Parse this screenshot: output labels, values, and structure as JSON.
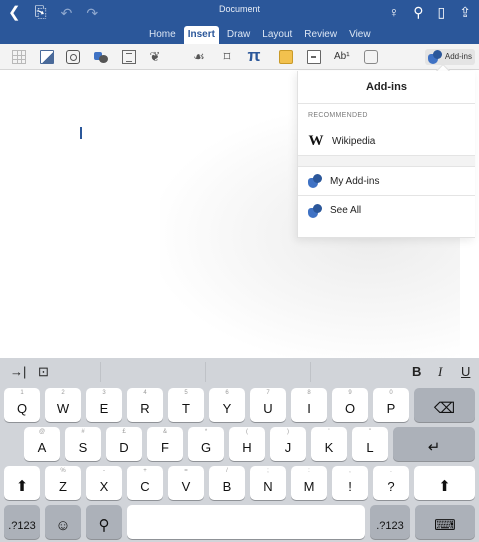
{
  "colors": {
    "titlebar_bg": "#2b579a",
    "ribbon_bg": "#f3f3f3",
    "keyboard_bg": "#d1d4d9",
    "key_bg": "#ffffff",
    "key_gray_bg": "#acb1b9"
  },
  "titlebar": {
    "doc_title": "Document",
    "left_icons": [
      "back-icon",
      "file-icon",
      "undo-icon",
      "redo-icon"
    ],
    "right_icons": [
      "lightbulb-icon",
      "search-icon",
      "tablet-icon",
      "share-icon"
    ],
    "back_glyph": "❮",
    "file_glyph": "⎘",
    "undo_glyph": "↶",
    "redo_glyph": "↷",
    "bulb_glyph": "♀",
    "search_glyph": "⚲",
    "tablet_glyph": "▯",
    "share_glyph": "⇪"
  },
  "tabs": [
    {
      "label": "Home",
      "active": false
    },
    {
      "label": "Insert",
      "active": true
    },
    {
      "label": "Draw",
      "active": false
    },
    {
      "label": "Layout",
      "active": false
    },
    {
      "label": "Review",
      "active": false
    },
    {
      "label": "View",
      "active": false
    }
  ],
  "ribbon": {
    "icons": [
      "table-icon",
      "picture-icon",
      "camera-icon",
      "shapes-icon",
      "textbox-icon",
      "smartart-icon",
      "symbols-icon",
      "comment-icon",
      "equation-icon",
      "header-icon",
      "page-number-icon",
      "footnote-icon",
      "link-icon"
    ],
    "smartart_glyph": "❦",
    "symbols_glyph": "☙",
    "comment_glyph": "⌑",
    "equation_glyph": "π",
    "footnote_label": "Ab¹",
    "addins_label": "Add-ins"
  },
  "popover": {
    "title": "Add-ins",
    "section_label": "RECOMMENDED",
    "recommended": [
      {
        "icon": "wikipedia-icon",
        "glyph": "W",
        "label": "Wikipedia"
      }
    ],
    "items": [
      {
        "icon": "my-addins-icon",
        "label": "My Add-ins"
      },
      {
        "icon": "see-all-icon",
        "label": "See All"
      }
    ]
  },
  "keyboard": {
    "toolbar": {
      "tab_glyph": "→|",
      "paste_glyph": "⊡",
      "bold": "B",
      "italic": "I",
      "underline": "U"
    },
    "row1": [
      {
        "ch": "Q",
        "hint": "1"
      },
      {
        "ch": "W",
        "hint": "2"
      },
      {
        "ch": "E",
        "hint": "3"
      },
      {
        "ch": "R",
        "hint": "4"
      },
      {
        "ch": "T",
        "hint": "5"
      },
      {
        "ch": "Y",
        "hint": "6"
      },
      {
        "ch": "U",
        "hint": "7"
      },
      {
        "ch": "I",
        "hint": "8"
      },
      {
        "ch": "O",
        "hint": "9"
      },
      {
        "ch": "P",
        "hint": "0"
      }
    ],
    "row2": [
      {
        "ch": "A",
        "hint": "@"
      },
      {
        "ch": "S",
        "hint": "#"
      },
      {
        "ch": "D",
        "hint": "£"
      },
      {
        "ch": "F",
        "hint": "&"
      },
      {
        "ch": "G",
        "hint": "*"
      },
      {
        "ch": "H",
        "hint": "("
      },
      {
        "ch": "J",
        "hint": ")"
      },
      {
        "ch": "K",
        "hint": "'"
      },
      {
        "ch": "L",
        "hint": "\""
      }
    ],
    "row3": [
      {
        "ch": "Z",
        "hint": "%"
      },
      {
        "ch": "X",
        "hint": "-"
      },
      {
        "ch": "C",
        "hint": "+"
      },
      {
        "ch": "V",
        "hint": "="
      },
      {
        "ch": "B",
        "hint": "/"
      },
      {
        "ch": "N",
        "hint": ";"
      },
      {
        "ch": "M",
        "hint": ":"
      },
      {
        "ch": "!",
        "hint": ","
      },
      {
        "ch": "?",
        "hint": "."
      }
    ],
    "delete_glyph": "⌫",
    "return_glyph": "↵",
    "shift_glyph": "⬆",
    "num_label": ".?123",
    "emoji_glyph": "☺",
    "mic_glyph": "⚲",
    "dismiss_glyph": "⌨"
  }
}
